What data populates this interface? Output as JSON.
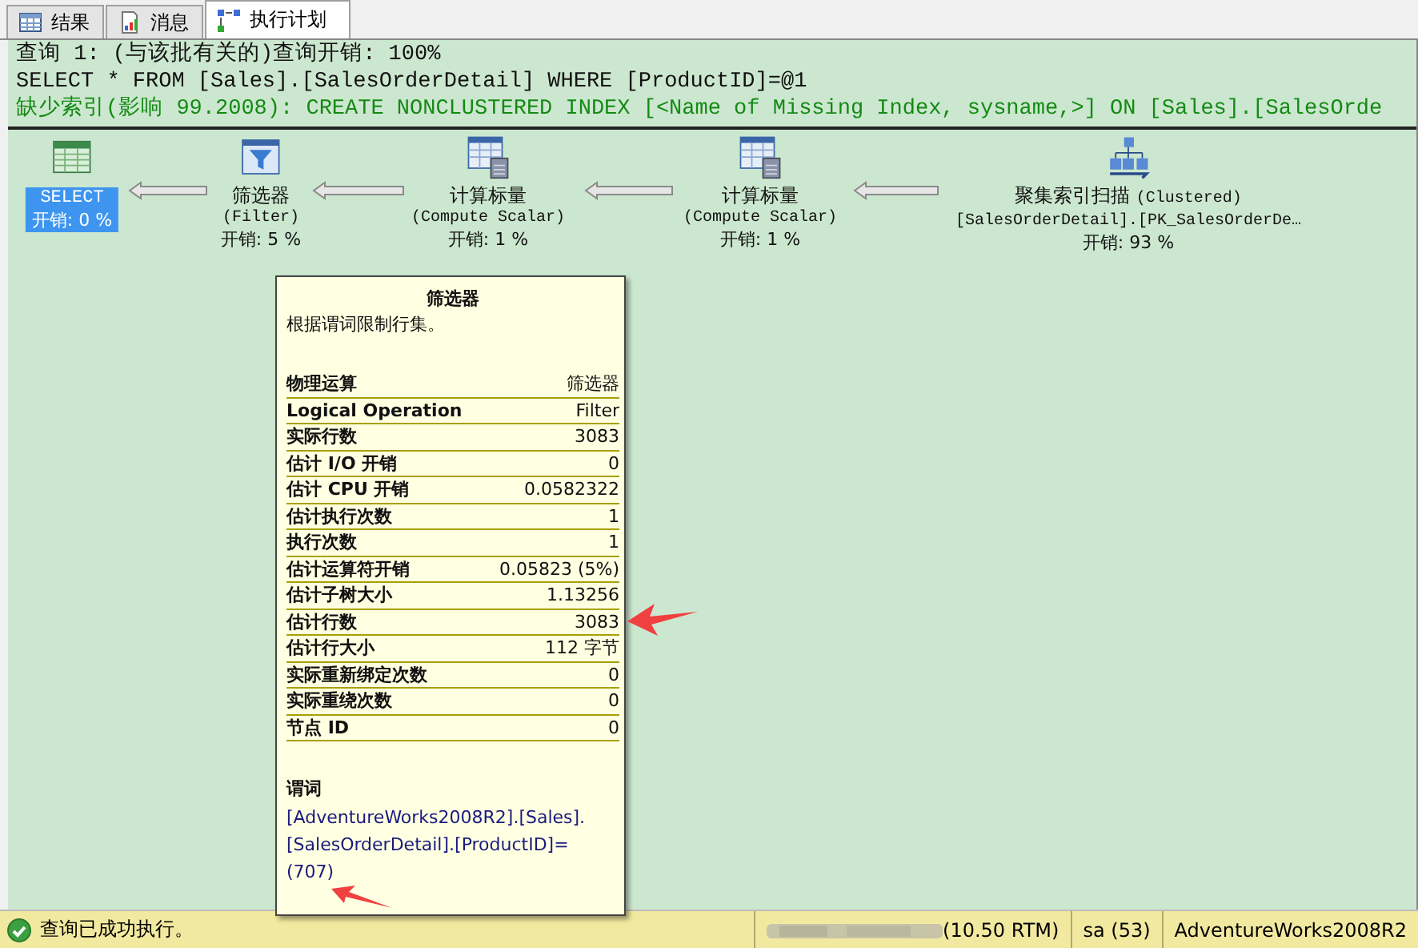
{
  "tabs": [
    {
      "label": "结果",
      "kind": "grid",
      "selected": false
    },
    {
      "label": "消息",
      "kind": "doc",
      "selected": false
    },
    {
      "label": "执行计划",
      "kind": "plan",
      "selected": true
    }
  ],
  "header": {
    "query_line": "查询 1: (与该批有关的)查询开销: 100%",
    "sql": "SELECT * FROM [Sales].[SalesOrderDetail] WHERE [ProductID]=@1",
    "missing_index": "缺少索引(影响 99.2008): CREATE NONCLUSTERED INDEX [<Name of Missing Index, sysname,>] ON [Sales].[SalesOrde"
  },
  "plan_nodes": [
    {
      "kind": "select",
      "name": "SELECT",
      "cost": "开销: 0 %",
      "selected": true
    },
    {
      "kind": "filter",
      "name": "筛选器",
      "subtitle": "(Filter)",
      "cost": "开销: 5 %",
      "selected": false
    },
    {
      "kind": "compute",
      "name": "计算标量",
      "subtitle": "(Compute Scalar)",
      "cost": "开销: 1 %",
      "selected": false
    },
    {
      "kind": "compute",
      "name": "计算标量",
      "subtitle": "(Compute Scalar)",
      "cost": "开销: 1 %",
      "selected": false
    },
    {
      "kind": "scan",
      "name": "聚集索引扫描",
      "subtitle": "(Clustered)",
      "object": "[SalesOrderDetail].[PK_SalesOrderDe…",
      "cost": "开销: 93 %",
      "selected": false
    }
  ],
  "tooltip": {
    "title": "筛选器",
    "description": "根据谓词限制行集。",
    "rows": [
      {
        "label": "物理运算",
        "value": "筛选器"
      },
      {
        "label": "Logical Operation",
        "value": "Filter"
      },
      {
        "label": "实际行数",
        "value": "3083"
      },
      {
        "label": "估计 I/O 开销",
        "value": "0"
      },
      {
        "label": "估计 CPU 开销",
        "value": "0.0582322"
      },
      {
        "label": "估计执行次数",
        "value": "1"
      },
      {
        "label": "执行次数",
        "value": "1"
      },
      {
        "label": "估计运算符开销",
        "value": "0.05823 (5%)"
      },
      {
        "label": "估计子树大小",
        "value": "1.13256"
      },
      {
        "label": "估计行数",
        "value": "3083"
      },
      {
        "label": "估计行大小",
        "value": "112 字节"
      },
      {
        "label": "实际重新绑定次数",
        "value": "0"
      },
      {
        "label": "实际重绕次数",
        "value": "0"
      },
      {
        "label": "节点 ID",
        "value": "0"
      }
    ],
    "predicate_label": "谓词",
    "predicate": "[AdventureWorks2008R2].[Sales].[SalesOrderDetail].[ProductID]=(707)"
  },
  "status_bar": {
    "message": "查询已成功执行。",
    "server_version": "(10.50 RTM)",
    "user": "sa (53)",
    "database": "AdventureWorks2008R2"
  }
}
